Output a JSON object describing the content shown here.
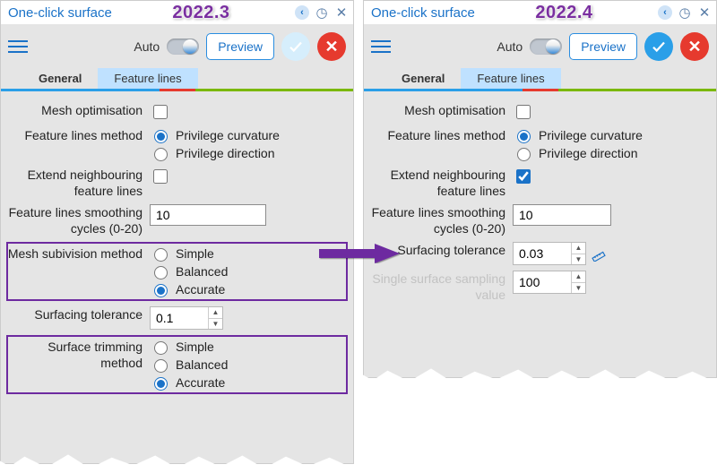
{
  "title": "One-click surface",
  "versionA": "2022.3",
  "versionB": "2022.4",
  "toolbar": {
    "auto": "Auto",
    "preview": "Preview"
  },
  "tabs": {
    "general": "General",
    "feature_lines": "Feature lines"
  },
  "labels": {
    "mesh_opt": "Mesh optimisation",
    "fl_method": "Feature lines method",
    "extend": "Extend neighbouring feature lines",
    "smoothing": "Feature lines smoothing cycles (0-20)",
    "subdiv": "Mesh subivision method",
    "surf_tol": "Surfacing tolerance",
    "trim": "Surface trimming method",
    "single_sample": "Single surface sampling value"
  },
  "opts": {
    "curvature": "Privilege curvature",
    "direction": "Privilege direction",
    "simple": "Simple",
    "balanced": "Balanced",
    "accurate": "Accurate"
  },
  "valsA": {
    "extend": false,
    "smoothing": "10",
    "surf_tol": "0.1"
  },
  "valsB": {
    "extend": true,
    "smoothing": "10",
    "surf_tol": "0.03",
    "single_sample": "100"
  }
}
